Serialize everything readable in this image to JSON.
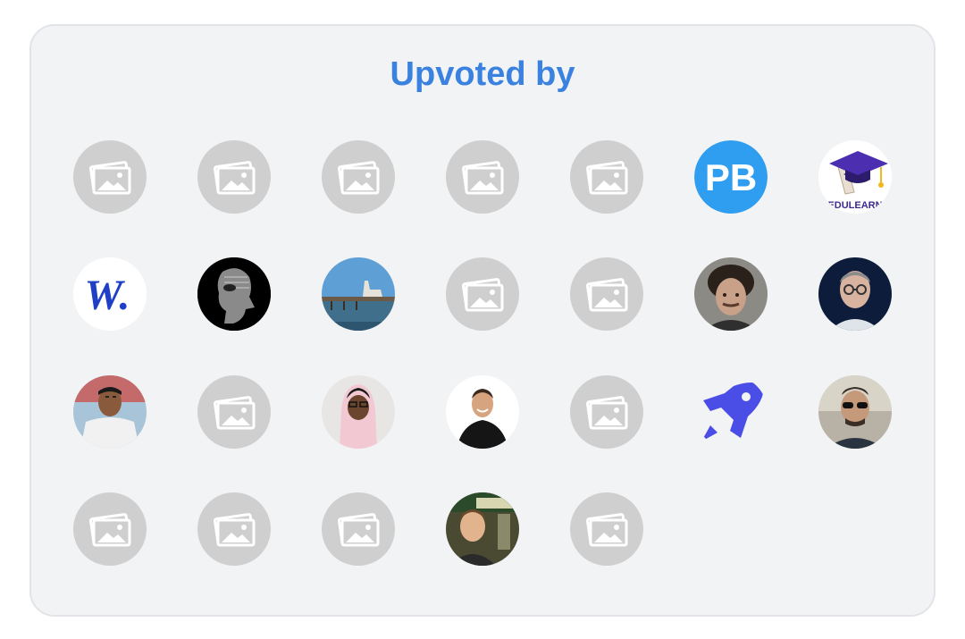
{
  "title": "Upvoted by",
  "colors": {
    "accent": "#3b82e0",
    "card_bg": "#f2f3f5",
    "placeholder_bg": "#cfcfcf"
  },
  "rows": [
    [
      "placeholder-image-icon",
      "placeholder-image-icon",
      "placeholder-image-icon",
      "placeholder-image-icon",
      "placeholder-image-icon",
      "pb-logo",
      "edulearn-logo"
    ],
    [
      "w-logo",
      "face-silhouette",
      "pier-photo",
      "placeholder-image-icon",
      "placeholder-image-icon",
      "curly-hair-man-photo",
      "glasses-man-photo"
    ],
    [
      "man-white-shirt-photo",
      "placeholder-image-icon",
      "hijab-woman-photo",
      "smiling-man-photo",
      "placeholder-image-icon",
      "rocket-logo",
      "sunglasses-man-photo"
    ],
    [
      "placeholder-image-icon",
      "placeholder-image-icon",
      "placeholder-image-icon",
      "cartoon-man-photo",
      "placeholder-image-icon"
    ]
  ],
  "avatar_texts": {
    "pb": "PB",
    "edulearn": "EDULEARN",
    "w": "W."
  }
}
